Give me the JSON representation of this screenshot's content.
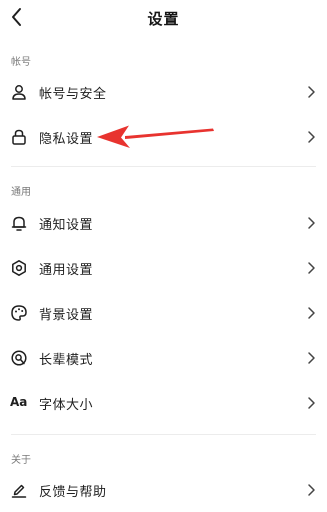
{
  "header": {
    "title": "设置"
  },
  "sections": [
    {
      "label": "帐号",
      "items": [
        {
          "label": "帐号与安全",
          "icon": "user-icon"
        },
        {
          "label": "隐私设置",
          "icon": "lock-icon"
        }
      ]
    },
    {
      "label": "通用",
      "items": [
        {
          "label": "通知设置",
          "icon": "bell-icon"
        },
        {
          "label": "通用设置",
          "icon": "gear-icon"
        },
        {
          "label": "背景设置",
          "icon": "palette-icon"
        },
        {
          "label": "长辈模式",
          "icon": "elder-mode-icon"
        },
        {
          "label": "字体大小",
          "icon": "font-size-icon",
          "glyph": "Aa"
        }
      ]
    },
    {
      "label": "关于",
      "items": [
        {
          "label": "反馈与帮助",
          "icon": "edit-icon"
        }
      ]
    }
  ],
  "annotation": {
    "arrow_color": "#e8332f"
  }
}
